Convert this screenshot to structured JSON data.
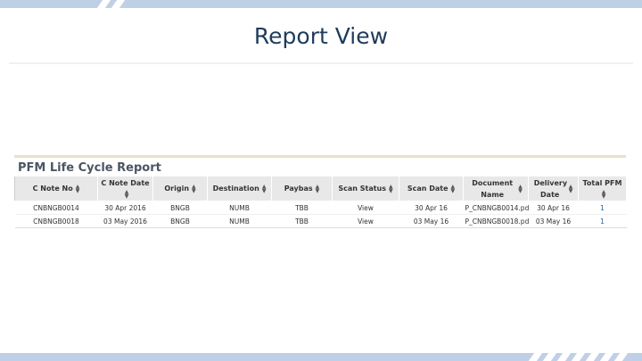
{
  "slide": {
    "title": "Report View"
  },
  "report": {
    "title": "PFM Life Cycle Report",
    "columns": [
      {
        "label": "C Note No"
      },
      {
        "label": "C Note Date"
      },
      {
        "label": "Origin"
      },
      {
        "label": "Destination"
      },
      {
        "label": "Paybas"
      },
      {
        "label": "Scan Status"
      },
      {
        "label": "Scan Date"
      },
      {
        "label": "Document Name"
      },
      {
        "label": "Delivery Date"
      },
      {
        "label": "Total PFM"
      }
    ],
    "rows": [
      [
        "CNBNGB0014",
        "30 Apr 2016",
        "BNGB",
        "NUMB",
        "TBB",
        "View",
        "30 Apr 16",
        "P_CNBNGB0014.pdf",
        "30 Apr 16",
        "1"
      ],
      [
        "CNBNGB0018",
        "03 May 2016",
        "BNGB",
        "NUMB",
        "TBB",
        "View",
        "03 May 16",
        "P_CNBNGB0018.pdf",
        "03 May 16",
        "1"
      ]
    ]
  },
  "colors": {
    "accent": "#1f3b5b",
    "band": "#bfd0e6",
    "header_bg": "#e8e8e8",
    "link": "#1f5fa8"
  },
  "icons": {
    "sort": "sort-icon"
  }
}
